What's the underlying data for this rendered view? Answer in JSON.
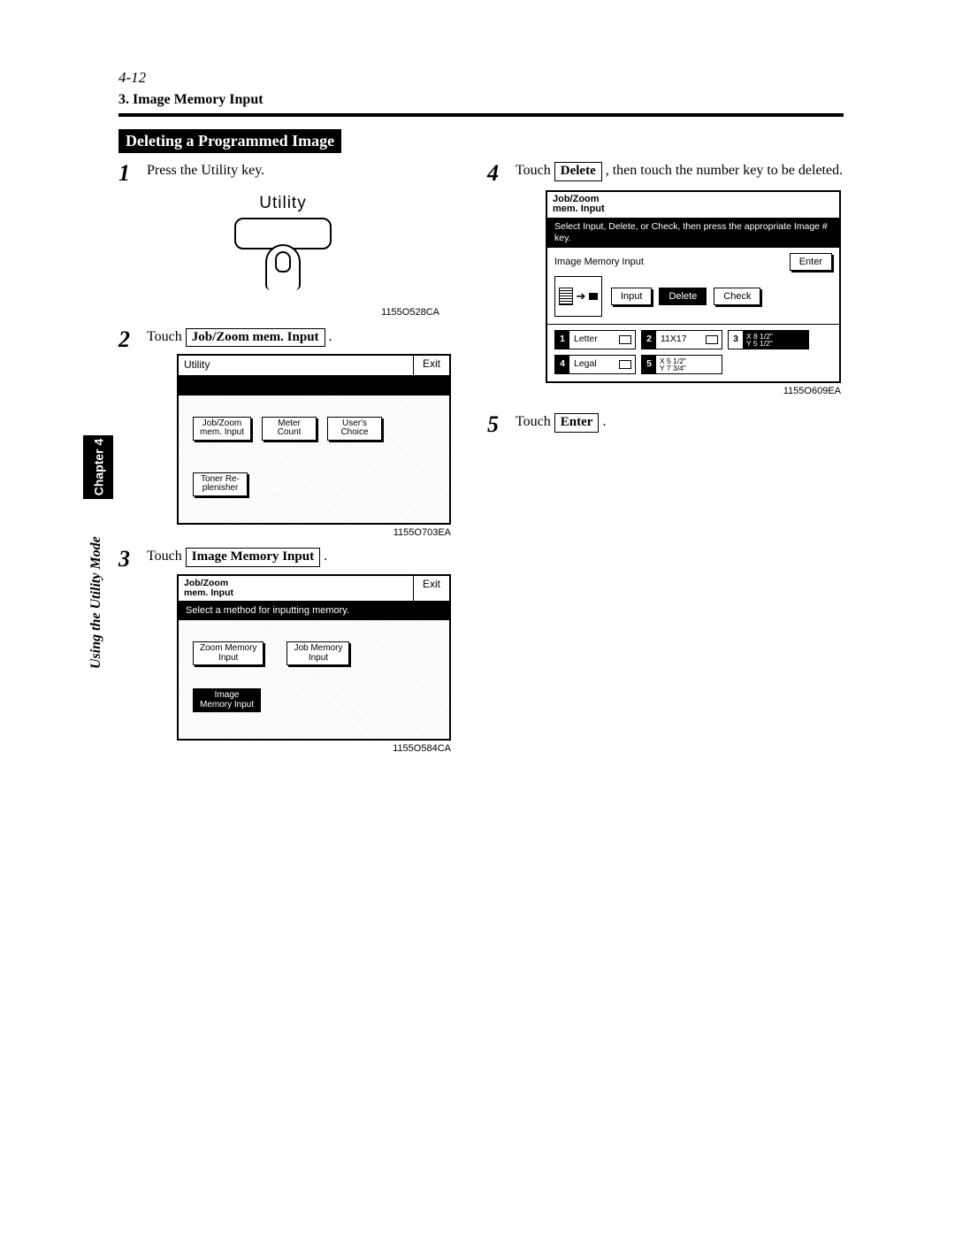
{
  "page_number": "4-12",
  "breadcrumb": "3. Image Memory Input",
  "heading": "Deleting a Programmed Image",
  "sidebar": {
    "tab": "Chapter 4",
    "mode": "Using the Utility Mode"
  },
  "steps": {
    "s1": {
      "num": "1",
      "text": "Press the Utility key.",
      "key_label": "Utility",
      "code": "1155O528CA"
    },
    "s2": {
      "num": "2",
      "pre": "Touch ",
      "btn": "Job/Zoom mem. Input",
      "post": " .",
      "screen": {
        "title": "Utility",
        "exit": "Exit",
        "b1": "Job/Zoom\nmem. Input",
        "b2": "Meter\nCount",
        "b3": "User's\nChoice",
        "b4": "Toner Re-\nplenisher"
      },
      "code": "1155O703EA"
    },
    "s3": {
      "num": "3",
      "pre": "Touch ",
      "btn": "Image Memory Input",
      "post": " .",
      "screen": {
        "title": "Job/Zoom\nmem. Input",
        "exit": "Exit",
        "band": "Select a method for inputting memory.",
        "b1": "Zoom Memory\nInput",
        "b2": "Job Memory\nInput",
        "b3": "Image\nMemory Input"
      },
      "code": "1155O584CA"
    },
    "s4": {
      "num": "4",
      "pre": "Touch ",
      "btn": "Delete",
      "post": " , then touch the number key to be deleted.",
      "screen": {
        "title": "Job/Zoom\nmem. Input",
        "band": "Select Input, Delete, or Check, then press the appropriate Image # key.",
        "label": "Image Memory Input",
        "enter": "Enter",
        "input": "Input",
        "delete": "Delete",
        "check": "Check",
        "slot1n": "1",
        "slot1t": "Letter",
        "slot2n": "2",
        "slot2t": "11X17",
        "slot3n": "3",
        "slot3t": "X 8 1/2\"\nY 5 1/2\"",
        "slot4n": "4",
        "slot4t": "Legal",
        "slot5n": "5",
        "slot5t": "X 5 1/2\"\nY 7 3/4\""
      },
      "code": "1155O609EA"
    },
    "s5": {
      "num": "5",
      "pre": "Touch ",
      "btn": "Enter",
      "post": " ."
    }
  }
}
